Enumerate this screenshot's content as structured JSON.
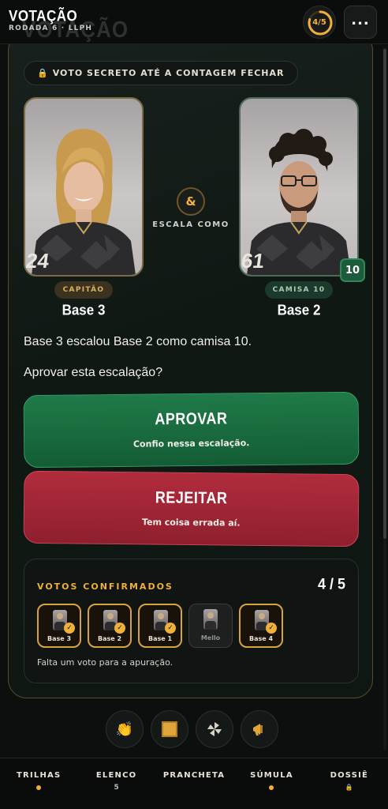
{
  "header": {
    "title": "VOTAÇÃO",
    "subtitle": "RODADA 6 · LLPH",
    "progress": "4/5",
    "progress_fraction": 0.8,
    "menu_icon": "ellipsis-icon"
  },
  "secret_notice": "VOTO SECRETO ATÉ A CONTAGEM FECHAR",
  "connector": {
    "symbol": "&",
    "label": "ESCALA COMO"
  },
  "left_player": {
    "jersey": "24",
    "role": "CAPITÃO",
    "name": "Base 3"
  },
  "right_player": {
    "jersey": "61",
    "badge": "10",
    "role": "CAMISA 10",
    "name": "Base 2"
  },
  "statement": "Base 3 escalou Base 2 como camisa 10.",
  "question": "Aprovar esta escalação?",
  "approve": {
    "label": "APROVAR",
    "sub": "Confio nessa escalação."
  },
  "reject": {
    "label": "REJEITAR",
    "sub": "Tem coisa errada aí."
  },
  "votes": {
    "title": "VOTOS CONFIRMADOS",
    "count": "4 / 5",
    "voters": [
      {
        "name": "Base 3",
        "voted": true
      },
      {
        "name": "Base 2",
        "voted": true
      },
      {
        "name": "Base 1",
        "voted": true
      },
      {
        "name": "Mello",
        "voted": false
      },
      {
        "name": "Base 4",
        "voted": true
      }
    ],
    "note": "Falta um voto para a apuração."
  },
  "reactions": [
    "clap-icon",
    "square-icon",
    "pinwheel-icon",
    "megaphone-icon"
  ],
  "nav": [
    {
      "label": "TRILHAS",
      "sub": "dot"
    },
    {
      "label": "ELENCO",
      "sub": "5"
    },
    {
      "label": "PRANCHETA",
      "sub": ""
    },
    {
      "label": "SÚMULA",
      "sub": "dot"
    },
    {
      "label": "DOSSIÊ",
      "sub": "lock"
    }
  ],
  "colors": {
    "accent": "#f0b03a",
    "approve": "#1f7a48",
    "reject": "#b12c3d",
    "background": "#0b0f0d"
  }
}
